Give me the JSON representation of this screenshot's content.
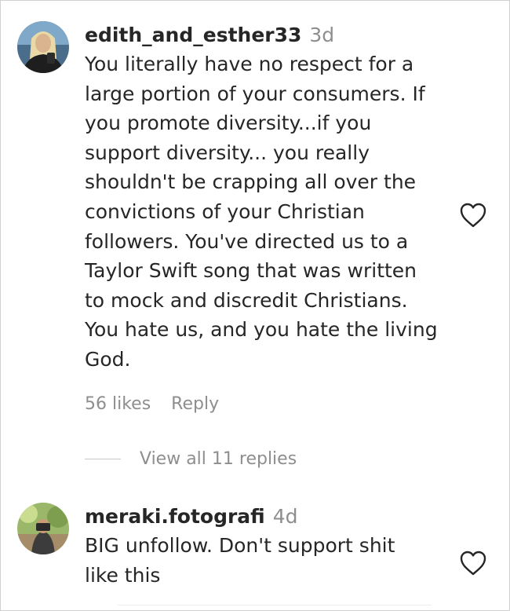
{
  "comments": [
    {
      "username": "edith_and_esther33",
      "time": "3d",
      "text_lines": [
        "You literally have no respect for a",
        "large portion of your consumers. If",
        "you promote diversity...if you",
        "support diversity... you really",
        "shouldn't be crapping all over the",
        "convictions of your Christian",
        "followers. You've directed us to a",
        "Taylor Swift song that was written",
        "to mock and discredit Christians.",
        "You hate us, and you hate the living",
        "God."
      ],
      "likes": "56 likes",
      "reply": "Reply",
      "view_replies": "View all 11 replies",
      "icons": {
        "avatar": "avatar-photo",
        "like": "heart-icon"
      }
    },
    {
      "username": "meraki.fotografi",
      "time": "4d",
      "text_lines": [
        "BIG unfollow. Don't support shit",
        "like this"
      ],
      "icons": {
        "avatar": "avatar-photo",
        "like": "heart-icon"
      }
    }
  ],
  "colors": {
    "text": "#262626",
    "secondary": "#8e8e8e",
    "divider": "#c7c7c7"
  }
}
